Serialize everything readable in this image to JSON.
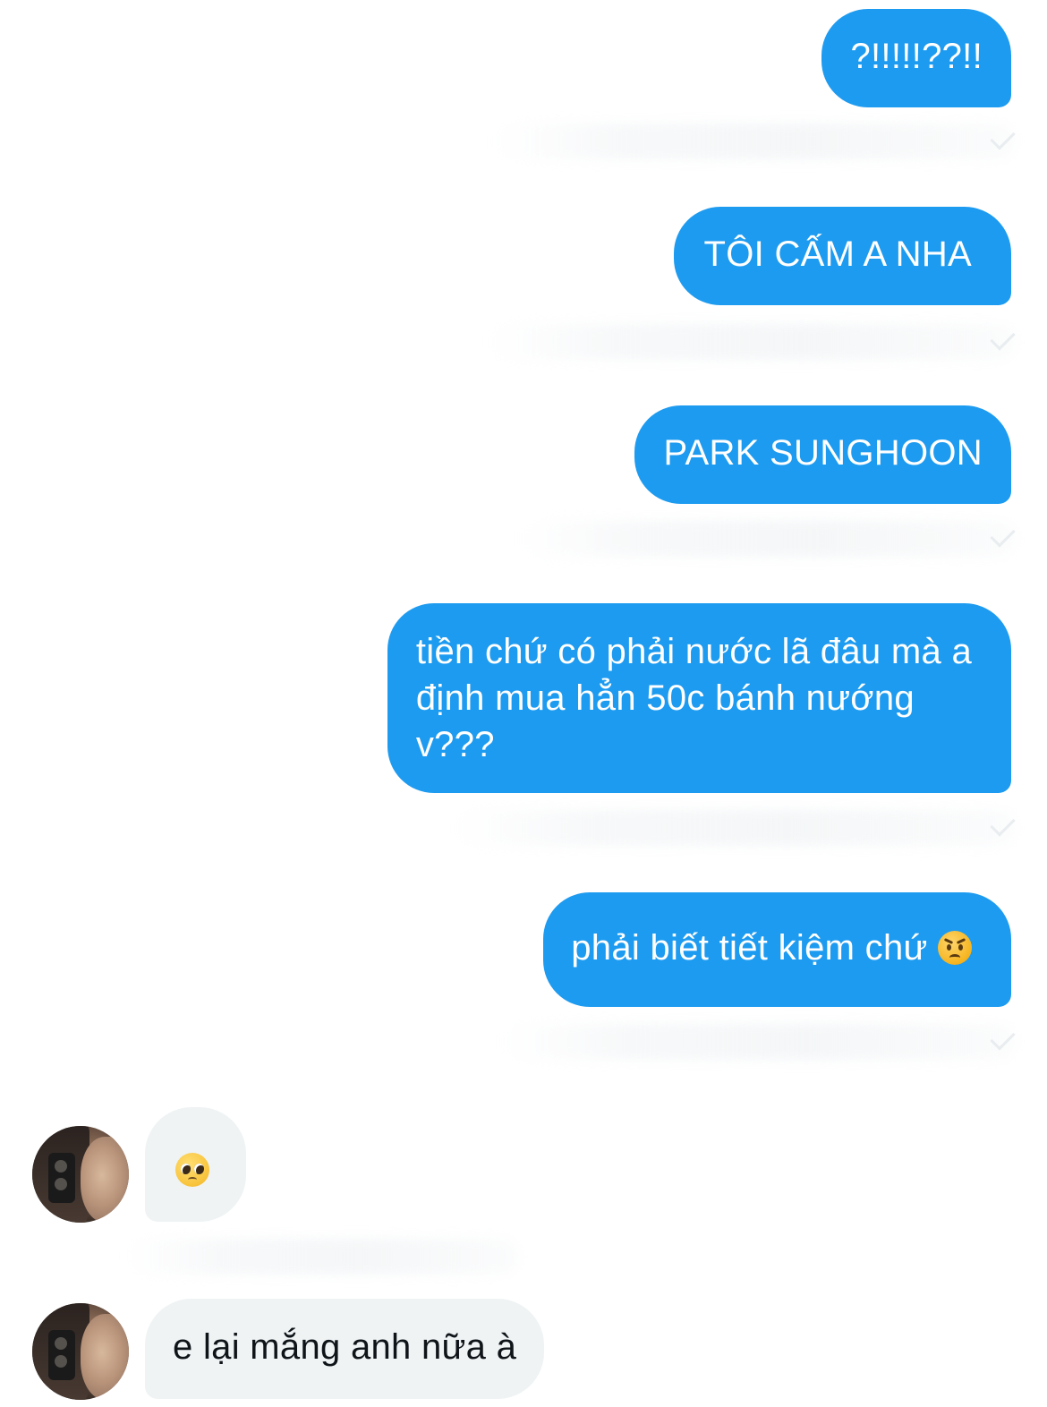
{
  "conversation": {
    "sent_messages": [
      {
        "text": "?!!!!!??!!"
      },
      {
        "text": "TÔI CẤM A NHA"
      },
      {
        "text": "PARK SUNGHOON"
      },
      {
        "text": "tiền chứ có phải nước lã đâu mà a\nđịnh mua hẳn 50c bánh nướng\nv???"
      },
      {
        "text": "phải biết tiết kiệm chứ",
        "emoji": "angry-face-icon"
      }
    ],
    "received_messages": [
      {
        "text": "",
        "emoji": "pleading-face-icon"
      },
      {
        "text": "e lại mắng anh nữa à"
      }
    ]
  },
  "colors": {
    "sent_bubble": "#1d9bf0",
    "received_bubble": "#eff3f4",
    "sent_text": "#ffffff",
    "received_text": "#0f1419"
  }
}
